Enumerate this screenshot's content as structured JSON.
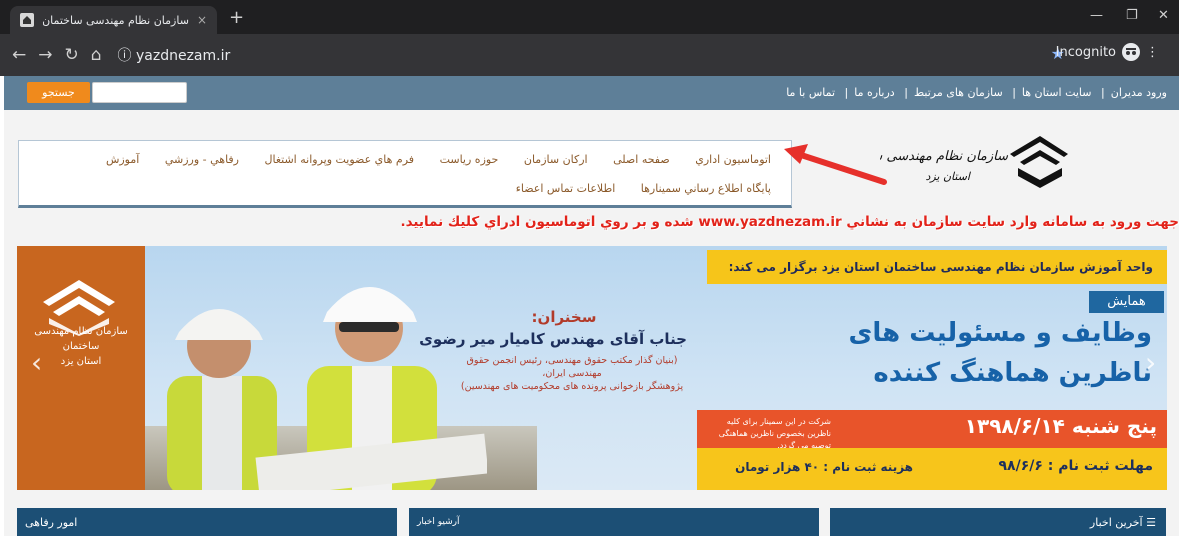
{
  "browser": {
    "tab_title": "سازمان نظام مهندسی ساختمان استان یزد",
    "tab_close": "×",
    "new_tab": "+",
    "url": "yazdnezam.ir",
    "incognito_label": "Incognito",
    "minimize": "—",
    "restore": "❐",
    "close": "✕"
  },
  "topnav": {
    "links": [
      "ورود مديران",
      "سايت استان ها",
      "سازمان های مرتبط",
      "درباره ما",
      "تماس با ما"
    ],
    "separator": "|",
    "search_button": "جستجو",
    "search_placeholder": ""
  },
  "menu": {
    "row1": [
      "اتوماسيون اداري",
      "صفحه اصلی",
      "ارکان سازمان",
      "حوزه رياست",
      "فرم هاي عضويت وپروانه اشتغال",
      "رفاهي - ورزشي",
      "آموزش"
    ],
    "row2": [
      "پايگاه اطلاع رساني سمينارها",
      "اطلاعات تماس اعضاء"
    ]
  },
  "logo": {
    "line1": "سازمان نظام مهندسی ساختمان",
    "line2": "استان یزد"
  },
  "announcement": "جهت ورود به سامانه وارد سايت سازمان به نشاني www.yazdnezam.ir شده و بر روي اتوماسيون ادراي كليك نماييد.",
  "banner": {
    "org_line1": "سازمان نظام مهندسی ساختمان",
    "org_line2": "استان یزد",
    "top_text": "واحد آموزش سازمان نظام مهندسی ساختمان استان یزد برگزار می کند:",
    "badge": "همایش",
    "title_line1": "وظایف و مسئولیت های",
    "title_line2": "ناظرین هماهنگ کننده",
    "speaker_label": "سخنران:",
    "speaker_name": "جناب آقای مهندس کامیار میر رضوی",
    "speaker_desc1": "(بنیان گذار مکتب حقوق مهندسی، رئیس انجمن حقوق مهندسی ایران،",
    "speaker_desc2": "پژوهشگر بازخوانی پرونده های محکومیت های مهندسین)",
    "participation_note": "شرکت در این سمینار برای کلیه ناظرین بخصوص ناظرین هماهنگی توصیه می گردد.",
    "date": "پنج شنبه ۱۳۹۸/۶/۱۴",
    "deadline": "مهلت ثبت نام : ۹۸/۶/۶",
    "cost": "هزینه ثبت نام : ۴۰ هزار تومان",
    "prev_arrow": "‹",
    "next_arrow": "›"
  },
  "bottom": {
    "latest_news": "آخرین اخبار",
    "news_archive": "آرشیو اخبار",
    "welfare": "امور رفاهی"
  },
  "colors": {
    "topnav_bg": "#5e7f98",
    "search_btn": "#f08a1c",
    "announcement": "#e2231a",
    "menu_text": "#8b5a2b",
    "arrow": "#e6302b",
    "footer_bar": "#1c4f75"
  }
}
